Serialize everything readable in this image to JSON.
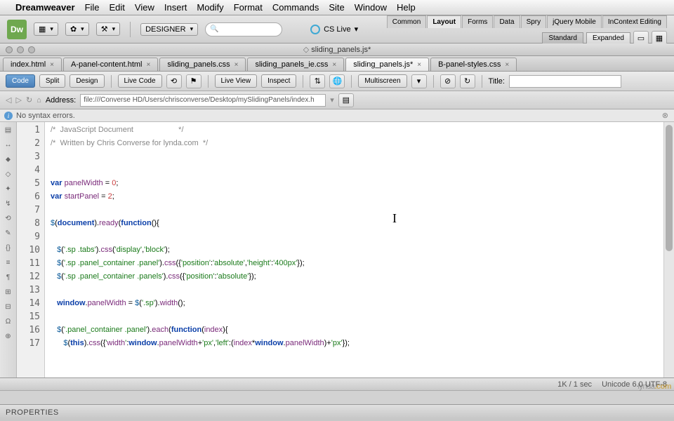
{
  "mac_menu": {
    "app": "Dreamweaver",
    "items": [
      "File",
      "Edit",
      "View",
      "Insert",
      "Modify",
      "Format",
      "Commands",
      "Site",
      "Window",
      "Help"
    ]
  },
  "toolbar": {
    "logo": "Dw",
    "designer": "DESIGNER",
    "cslive": "CS Live"
  },
  "right_panel": {
    "cats": [
      "Common",
      "Layout",
      "Forms",
      "Data",
      "Spry",
      "jQuery Mobile",
      "InContext Editing"
    ],
    "active_cat": 1,
    "segs": [
      "Standard",
      "Expanded"
    ],
    "active_seg": 0
  },
  "window": {
    "title": "sliding_panels.js*"
  },
  "doc_tabs": [
    {
      "label": "index.html",
      "active": false
    },
    {
      "label": "A-panel-content.html",
      "active": false
    },
    {
      "label": "sliding_panels.css",
      "active": false
    },
    {
      "label": "sliding_panels_ie.css",
      "active": false
    },
    {
      "label": "sliding_panels.js*",
      "active": true
    },
    {
      "label": "B-panel-styles.css",
      "active": false
    }
  ],
  "view_toolbar": {
    "code": "Code",
    "split": "Split",
    "design": "Design",
    "livecode": "Live Code",
    "liveview": "Live View",
    "inspect": "Inspect",
    "multiscreen": "Multiscreen",
    "title_label": "Title:",
    "title_value": ""
  },
  "address": {
    "label": "Address:",
    "value": "file:///Converse HD/Users/chrisconverse/Desktop/mySlidingPanels/index.h"
  },
  "syntax": {
    "msg": "No syntax errors."
  },
  "code_lines": [
    "/*  JavaScript Document                     */",
    "/*  Written by Chris Converse for lynda.com  */",
    "",
    "",
    "var panelWidth = 0;",
    "var startPanel = 2;",
    "",
    "$(document).ready(function(){",
    "",
    "   $('.sp .tabs').css('display','block');",
    "   $('.sp .panel_container .panel').css({'position':'absolute','height':'400px'});",
    "   $('.sp .panel_container .panels').css({'position':'absolute'});",
    "",
    "   window.panelWidth = $('.sp').width();",
    "",
    "   $('.panel_container .panel').each(function(index){",
    "      $(this).css({'width':window.panelWidth+'px','left':(index*window.panelWidth)+'px'});"
  ],
  "status": {
    "size": "1K / 1 sec",
    "encoding": "Unicode 6.0 UTF-8"
  },
  "properties": {
    "label": "PROPERTIES"
  },
  "lynda": {
    "a": "lynda",
    "b": ".com"
  }
}
